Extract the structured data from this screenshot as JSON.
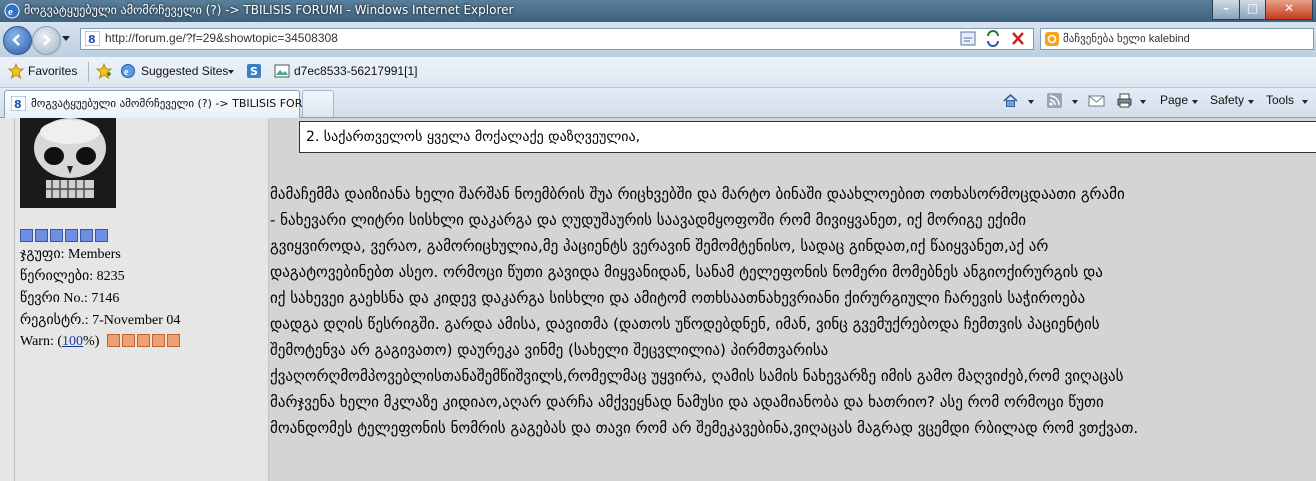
{
  "window": {
    "title": "მოგვატყუებული ამომრჩეველი (?) -> TBILISIS FORUMI - Windows Internet Explorer"
  },
  "address_bar": {
    "url": "http://forum.ge/?f=29&showtopic=34508308"
  },
  "search_box": {
    "placeholder": "მაჩვენება ხელი kalebind"
  },
  "favorites_bar": {
    "favorites_label": "Favorites",
    "suggested_sites_label": "Suggested Sites",
    "item_label": "d7ec8533-56217991[1]"
  },
  "tab": {
    "label": "მოგვატყუებული ამომრჩეველი (?) -> TBILISIS FORU..."
  },
  "command_bar": {
    "page_label": "Page",
    "safety_label": "Safety",
    "tools_label": "Tools"
  },
  "user_info": {
    "group": "ჯგუფი: Members",
    "posts": "წერილები: 8235",
    "member_no": "წევრი No.: 7146",
    "registered": "რეგისტრ.: 7-November 04",
    "warn_prefix": "Warn: (",
    "warn_value": "100",
    "warn_suffix": "%)",
    "rank_pips": 6,
    "warn_pips": 5
  },
  "quote": {
    "text": "2. საქართველოს ყველა მოქალაქე დაზღვეულია,"
  },
  "post": {
    "lines": [
      "მამაჩემმა დაიზიანა ხელი შარშან ნოემბრის შუა რიცხვებში და მარტო ბინაში დაახლოებით ოთხასორმოცდაათი გრამი",
      "- ნახევარი ლიტრი სისხლი დაკარგა და ღუდუშაურის საავადმყოფოში რომ მივიყვანეთ, იქ მორიგე ექიმი",
      "გვიყვიროდა, ვერაო, გამორიცხულია,მე პაციენტს ვერავინ შემომტენისო, სადაც გინდათ,იქ წაიყვანეთ,აქ არ",
      "დაგატოვებინებთ ასეო. ორმოცი წუთი გავიდა მიყვანიდან, სანამ ტელეფონის ნომერი მომებნეს ანგიოქირურგის და",
      "იქ სახევეი გაეხსნა და კიდევ დაკარგა სისხლი და ამიტომ ოთხსაათნახევრიანი ქირურგიული ჩარევის საჭიროება",
      "დადგა დღის წესრიგში. გარდა ამისა, დავითმა (დათოს უწოდებდნენ, იმან, ვინც გვემუქრებოდა ჩემთვის პაციენტის",
      "შემოტენვა არ გაგივათო) დაურეკა ვინმე (სახელი შეცვლილია) პირმთვარისა",
      "ქვაღორღმომპოვებლისთანაშემწიშვილს,რომელმაც უყვირა, ღამის სამის ნახევარზე იმის გამო მაღვიძებ,რომ ვიღაცას",
      "მარჯვენა ხელი მკლაზე კიდიაო,აღარ დარჩა ამქვეყნად ნამუსი და ადამიანობა და ხათრიო? ასე რომ ორმოცი წუთი",
      "მოანდომეს ტელეფონის ნომრის გაგებას და თავი რომ არ შემეკავებინა,ვიღაცას მაგრად ვცემდი რბილად რომ ვთქვათ."
    ]
  }
}
